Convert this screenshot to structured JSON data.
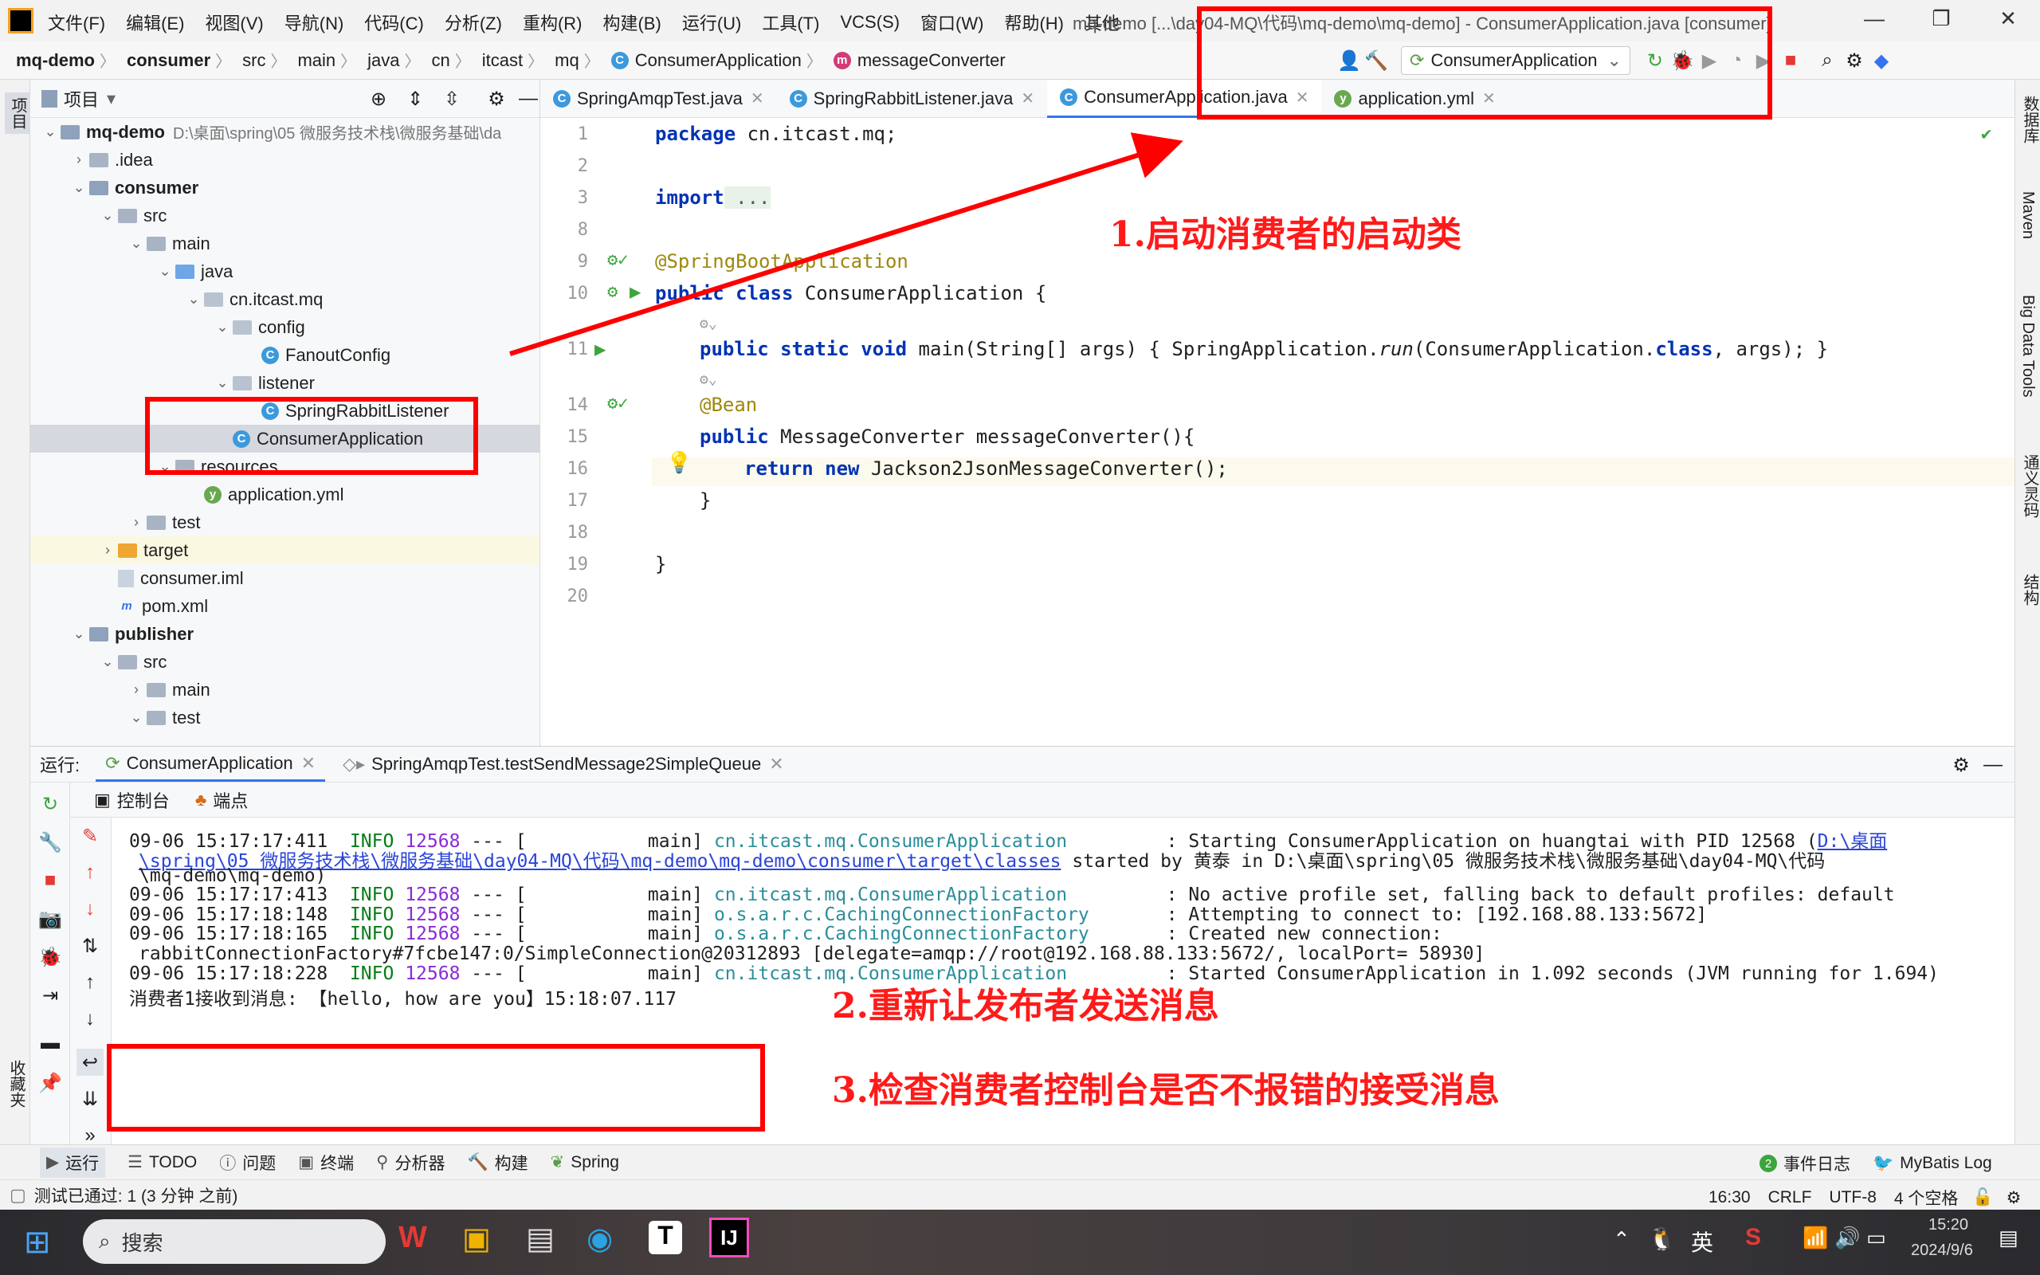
{
  "menubar": {
    "items": [
      "文件(F)",
      "编辑(E)",
      "视图(V)",
      "导航(N)",
      "代码(C)",
      "分析(Z)",
      "重构(R)",
      "构建(B)",
      "运行(U)",
      "工具(T)",
      "VCS(S)",
      "窗口(W)",
      "帮助(H)",
      "其他"
    ],
    "title": "mq-demo [...\\day04-MQ\\代码\\mq-demo\\mq-demo] - ConsumerApplication.java [consumer]"
  },
  "navbar": {
    "breadcrumbs": [
      "mq-demo",
      "consumer",
      "src",
      "main",
      "java",
      "cn",
      "itcast",
      "mq",
      "ConsumerApplication",
      "messageConverter"
    ],
    "run_config": "ConsumerApplication"
  },
  "left_strip": {
    "project_label": "项目",
    "favorites_label": "收藏夹"
  },
  "project_panel": {
    "title": "项目",
    "tree": [
      {
        "label": "mq-demo",
        "extra": "D:\\桌面\\spring\\05 微服务技术栈\\微服务基础\\da",
        "depth": 0,
        "icon": "module",
        "expanded": true,
        "bold": true
      },
      {
        "label": ".idea",
        "depth": 1,
        "icon": "folder",
        "expanded": false
      },
      {
        "label": "consumer",
        "depth": 1,
        "icon": "module",
        "expanded": true,
        "bold": true
      },
      {
        "label": "src",
        "depth": 2,
        "icon": "folder",
        "expanded": true
      },
      {
        "label": "main",
        "depth": 3,
        "icon": "folder",
        "expanded": true
      },
      {
        "label": "java",
        "depth": 4,
        "icon": "folder-blue",
        "expanded": true
      },
      {
        "label": "cn.itcast.mq",
        "depth": 5,
        "icon": "package",
        "expanded": true
      },
      {
        "label": "config",
        "depth": 6,
        "icon": "package",
        "expanded": true
      },
      {
        "label": "FanoutConfig",
        "depth": 7,
        "icon": "class"
      },
      {
        "label": "listener",
        "depth": 6,
        "icon": "package",
        "expanded": true
      },
      {
        "label": "SpringRabbitListener",
        "depth": 7,
        "icon": "class"
      },
      {
        "label": "ConsumerApplication",
        "depth": 6,
        "icon": "class",
        "selected": true
      },
      {
        "label": "resources",
        "depth": 4,
        "icon": "folder",
        "expanded": true
      },
      {
        "label": "application.yml",
        "depth": 5,
        "icon": "yml"
      },
      {
        "label": "test",
        "depth": 3,
        "icon": "folder",
        "expanded": false
      },
      {
        "label": "target",
        "depth": 2,
        "icon": "folder-orange",
        "expanded": false,
        "highlight": true
      },
      {
        "label": "consumer.iml",
        "depth": 2,
        "icon": "file"
      },
      {
        "label": "pom.xml",
        "depth": 2,
        "icon": "maven"
      },
      {
        "label": "publisher",
        "depth": 1,
        "icon": "module",
        "expanded": true,
        "bold": true
      },
      {
        "label": "src",
        "depth": 2,
        "icon": "folder",
        "expanded": true
      },
      {
        "label": "main",
        "depth": 3,
        "icon": "folder",
        "expanded": false
      },
      {
        "label": "test",
        "depth": 3,
        "icon": "folder",
        "expanded": true
      }
    ]
  },
  "editor": {
    "tabs": [
      {
        "label": "SpringAmqpTest.java",
        "active": false
      },
      {
        "label": "SpringRabbitListener.java",
        "active": false
      },
      {
        "label": "ConsumerApplication.java",
        "active": true
      },
      {
        "label": "application.yml",
        "active": false
      }
    ],
    "line_numbers": [
      "1",
      "2",
      "3",
      "8",
      "9",
      "10",
      "",
      "11",
      "",
      "14",
      "15",
      "16",
      "17",
      "18",
      "19",
      "20"
    ],
    "code": {
      "l1_kw": "package",
      "l1_rest": " cn.itcast.mq;",
      "l3_kw": "import",
      "l3_rest": " ...",
      "l9": "@SpringBootApplication",
      "l10_kw": "public class",
      "l10_rest": " ConsumerApplication {",
      "l11_kw": "public static void",
      "l11_a": " main(String[] args) { SpringApplication.",
      "l11_run": "run",
      "l11_b": "(ConsumerApplication.",
      "l11_class": "class",
      "l11_c": ", args); }",
      "l14": "@Bean",
      "l15_kw": "public",
      "l15_rest": " MessageConverter messageConverter(){",
      "l16_kw": "return new",
      "l16_rest": " Jackson2JsonMessageConverter();",
      "l17": "}",
      "l19": "}"
    }
  },
  "right_strip": [
    "数据库",
    "Maven",
    "Big Data Tools",
    "通义灵码",
    "结构"
  ],
  "run_panel": {
    "label": "运行:",
    "tabs": [
      "ConsumerApplication",
      "SpringAmqpTest.testSendMessage2SimpleQueue"
    ],
    "subtabs": [
      "控制台",
      "端点"
    ]
  },
  "console": {
    "lines": [
      {
        "ts": "09-06 15:17:17:411",
        "level": "INFO",
        "pid": "12568",
        "mid": " --- [           main] ",
        "logger": "cn.itcast.mq.ConsumerApplication",
        "msg": "         : Starting ConsumerApplication on huangtai with PID 12568 (",
        "link": "D:\\桌面"
      },
      {
        "link": "\\spring\\05 微服务技术栈\\微服务基础\\day04-MQ\\代码\\mq-demo\\mq-demo\\consumer\\target\\classes",
        "msg": " started by 黄泰 in D:\\桌面\\spring\\05 微服务技术栈\\微服务基础\\day04-MQ\\代码"
      },
      {
        "msg": "\\mq-demo\\mq-demo)"
      },
      {
        "ts": "09-06 15:17:17:413",
        "level": "INFO",
        "pid": "12568",
        "mid": " --- [           main] ",
        "logger": "cn.itcast.mq.ConsumerApplication",
        "msg": "         : No active profile set, falling back to default profiles: default"
      },
      {
        "ts": "09-06 15:17:18:148",
        "level": "INFO",
        "pid": "12568",
        "mid": " --- [           main] ",
        "logger": "o.s.a.r.c.CachingConnectionFactory",
        "msg": "       : Attempting to connect to: [192.168.88.133:5672]"
      },
      {
        "ts": "09-06 15:17:18:165",
        "level": "INFO",
        "pid": "12568",
        "mid": " --- [           main] ",
        "logger": "o.s.a.r.c.CachingConnectionFactory",
        "msg": "       : Created new connection:"
      },
      {
        "msg": "rabbitConnectionFactory#7fcbe147:0/SimpleConnection@20312893 [delegate=amqp://root@192.168.88.133:5672/, localPort= 58930]"
      },
      {
        "ts": "09-06 15:17:18:228",
        "level": "INFO",
        "pid": "12568",
        "mid": " --- [           main] ",
        "logger": "cn.itcast.mq.ConsumerApplication",
        "msg": "         : Started ConsumerApplication in 1.092 seconds (JVM running for 1.694)"
      },
      {
        "msg": "消费者1接收到消息: 【hello, how are you】15:18:07.117"
      }
    ]
  },
  "bottom_tools": {
    "left": [
      "运行",
      "TODO",
      "问题",
      "终端",
      "分析器",
      "构建",
      "Spring"
    ],
    "right": [
      "事件日志",
      "MyBatis Log"
    ],
    "event_count": "2"
  },
  "statusbar": {
    "message": "测试已通过: 1 (3 分钟 之前)",
    "position": "16:30",
    "line_sep": "CRLF",
    "encoding": "UTF-8",
    "indent": "4 个空格"
  },
  "taskbar": {
    "search_placeholder": "搜索",
    "ime": "英",
    "time": "15:20",
    "date": "2024/9/6"
  },
  "annotations": {
    "step1": "1.启动消费者的启动类",
    "step2": "2.重新让发布者发送消息",
    "step3": "3.检查消费者控制台是否不报错的接受消息",
    "color": "#ff0000"
  }
}
